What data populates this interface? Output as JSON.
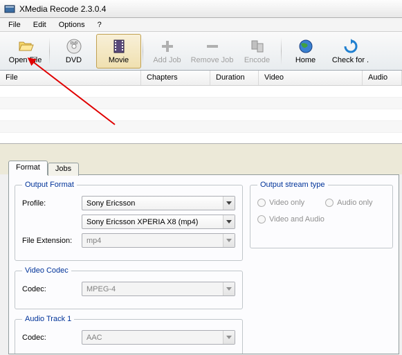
{
  "title": "XMedia Recode 2.3.0.4",
  "menu": {
    "file": "File",
    "edit": "Edit",
    "options": "Options",
    "help": "?"
  },
  "toolbar": {
    "open_file": "Open File",
    "dvd": "DVD",
    "movie": "Movie",
    "add_job": "Add Job",
    "remove_job": "Remove Job",
    "encode": "Encode",
    "home": "Home",
    "check": "Check for ."
  },
  "columns": {
    "file": "File",
    "chapters": "Chapters",
    "duration": "Duration",
    "video": "Video",
    "audio": "Audio"
  },
  "tabs": {
    "format": "Format",
    "jobs": "Jobs"
  },
  "output_format": {
    "legend": "Output Format",
    "profile_label": "Profile:",
    "profile_value": "Sony Ericsson",
    "device_value": "Sony Ericsson XPERIA X8 (mp4)",
    "ext_label": "File Extension:",
    "ext_value": "mp4"
  },
  "video_codec": {
    "legend": "Video Codec",
    "label": "Codec:",
    "value": "MPEG-4"
  },
  "audio_track": {
    "legend": "Audio Track 1",
    "label": "Codec:",
    "value": "AAC"
  },
  "stream_type": {
    "legend": "Output stream type",
    "video_only": "Video only",
    "audio_only": "Audio only",
    "video_and_audio": "Video and Audio"
  }
}
